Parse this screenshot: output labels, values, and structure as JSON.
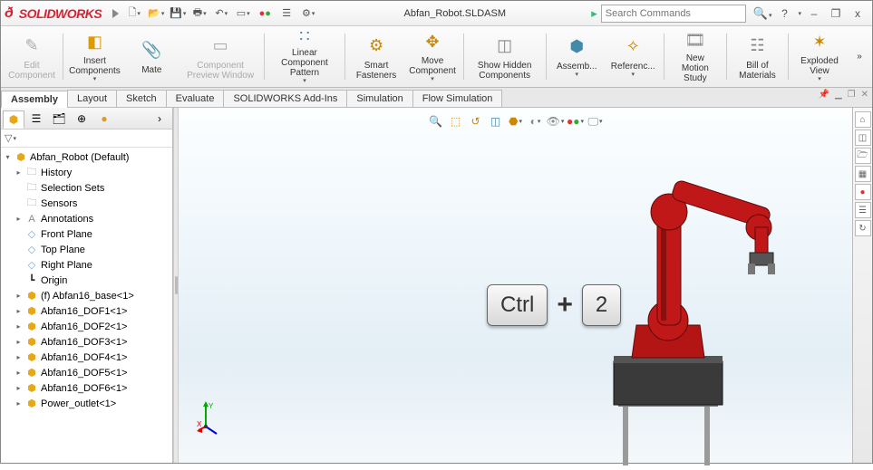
{
  "app": {
    "logo_text": "SOLIDWORKS",
    "doc_title": "Abfan_Robot.SLDASM"
  },
  "search": {
    "placeholder": "Search Commands"
  },
  "title_right": {
    "help": "?",
    "min": "–",
    "close": "x"
  },
  "ribbon": {
    "edit_component": "Edit Component",
    "insert_components": "Insert Components",
    "mate": "Mate",
    "component_preview": "Component Preview Window",
    "linear_pattern": "Linear Component Pattern",
    "smart_fasteners": "Smart Fasteners",
    "move_component": "Move Component",
    "show_hidden": "Show Hidden Components",
    "assembly_feat": "Assemb...",
    "reference": "Referenc...",
    "new_motion": "New Motion Study",
    "bom": "Bill of Materials",
    "exploded": "Exploded View"
  },
  "tabs": [
    "Assembly",
    "Layout",
    "Sketch",
    "Evaluate",
    "SOLIDWORKS Add-Ins",
    "Simulation",
    "Flow Simulation"
  ],
  "tree": {
    "root": "Abfan_Robot  (Default)",
    "items": [
      {
        "icon": "folder",
        "label": "History",
        "exp": "▸"
      },
      {
        "icon": "folder",
        "label": "Selection Sets",
        "exp": ""
      },
      {
        "icon": "folder",
        "label": "Sensors",
        "exp": ""
      },
      {
        "icon": "ann",
        "label": "Annotations",
        "exp": "▸"
      },
      {
        "icon": "plane",
        "label": "Front Plane",
        "exp": ""
      },
      {
        "icon": "plane",
        "label": "Top Plane",
        "exp": ""
      },
      {
        "icon": "plane",
        "label": "Right Plane",
        "exp": ""
      },
      {
        "icon": "origin",
        "label": "Origin",
        "exp": ""
      },
      {
        "icon": "part",
        "label": "(f) Abfan16_base<1>",
        "exp": "▸"
      },
      {
        "icon": "part",
        "label": "Abfan16_DOF1<1>",
        "exp": "▸"
      },
      {
        "icon": "part",
        "label": "Abfan16_DOF2<1>",
        "exp": "▸"
      },
      {
        "icon": "part",
        "label": "Abfan16_DOF3<1>",
        "exp": "▸"
      },
      {
        "icon": "part",
        "label": "Abfan16_DOF4<1>",
        "exp": "▸"
      },
      {
        "icon": "part",
        "label": "Abfan16_DOF5<1>",
        "exp": "▸"
      },
      {
        "icon": "part",
        "label": "Abfan16_DOF6<1>",
        "exp": "▸"
      },
      {
        "icon": "part",
        "label": "Power_outlet<1>",
        "exp": "▸"
      }
    ]
  },
  "overlay": {
    "key1": "Ctrl",
    "plus": "+",
    "key2": "2"
  },
  "triad": {
    "x": "X",
    "y": "Y"
  },
  "colors": {
    "brand": "#d92231",
    "robot": "#c01818",
    "robot_dark": "#6b0b0b",
    "metal": "#7a7a7a"
  }
}
